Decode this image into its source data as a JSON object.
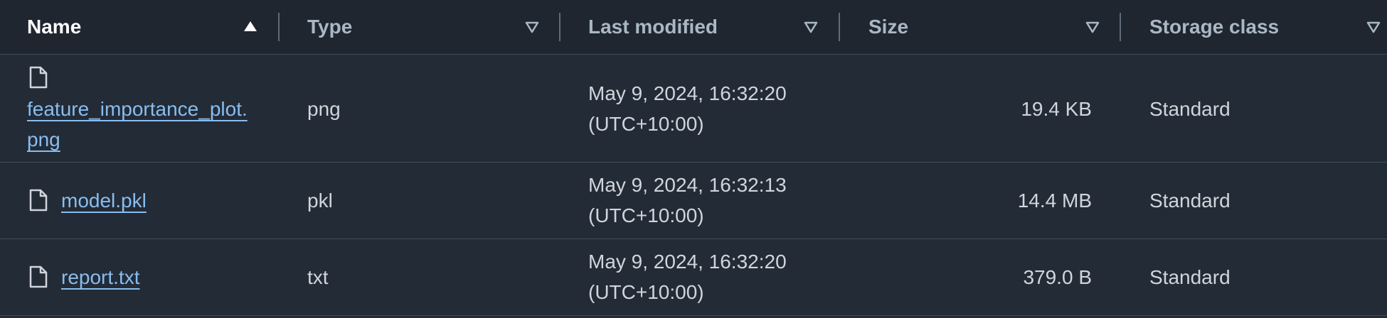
{
  "columns": {
    "name": "Name",
    "type": "Type",
    "last_modified": "Last modified",
    "size": "Size",
    "storage_class": "Storage class"
  },
  "sort": {
    "active_column": "name",
    "active_icon": "sort-ascending-icon",
    "inactive_icon": "sort-descending-outline-icon"
  },
  "rows": [
    {
      "name": "feature_importance_plot.png",
      "type": "png",
      "modified_date": "May 9, 2024, 16:32:20",
      "modified_tz": "(UTC+10:00)",
      "size": "19.4 KB",
      "storage_class": "Standard",
      "icon": "file-icon"
    },
    {
      "name": "model.pkl",
      "type": "pkl",
      "modified_date": "May 9, 2024, 16:32:13",
      "modified_tz": "(UTC+10:00)",
      "size": "14.4 MB",
      "storage_class": "Standard",
      "icon": "file-icon"
    },
    {
      "name": "report.txt",
      "type": "txt",
      "modified_date": "May 9, 2024, 16:32:20",
      "modified_tz": "(UTC+10:00)",
      "size": "379.0 B",
      "storage_class": "Standard",
      "icon": "file-icon"
    }
  ],
  "colors": {
    "background": "#232b37",
    "header_background": "#1f2630",
    "link": "#89bdee",
    "text": "#d1d5db",
    "header_text": "#aab7c4"
  }
}
